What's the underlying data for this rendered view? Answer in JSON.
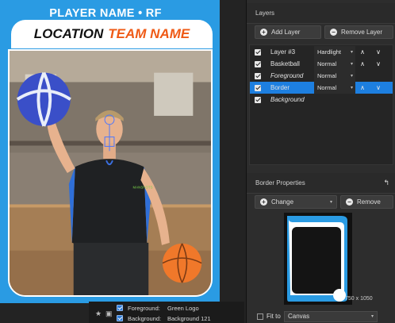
{
  "card": {
    "player_line": "PLAYER NAME • RF",
    "location": "LOCATION",
    "team": "TEAM NAME",
    "shirt_logo": "MANSHOTS"
  },
  "fgbg": {
    "foreground_label": "Foreground:",
    "foreground_value": "Green Logo",
    "background_label": "Background:",
    "background_value": "Background 121"
  },
  "layers": {
    "title": "Layers",
    "add_label": "Add Layer",
    "remove_label": "Remove Layer",
    "rows": [
      {
        "name": "Layer #3",
        "mode": "Hardlight",
        "italic": false,
        "selected": false
      },
      {
        "name": "Basketball",
        "mode": "Normal",
        "italic": false,
        "selected": false
      },
      {
        "name": "Foreground",
        "mode": "Normal",
        "italic": true,
        "selected": false
      },
      {
        "name": "Border",
        "mode": "Normal",
        "italic": false,
        "selected": true
      },
      {
        "name": "Background",
        "mode": "",
        "italic": true,
        "selected": false
      }
    ]
  },
  "border_props": {
    "title": "Border Properties",
    "change_label": "Change",
    "remove_label": "Remove",
    "dimensions": "750 x 1050",
    "fit_label": "Fit to",
    "fit_value": "Canvas"
  },
  "colors": {
    "card_blue": "#2a9be3",
    "team_orange": "#ef5a16",
    "selection_blue": "#1d7fe0"
  }
}
